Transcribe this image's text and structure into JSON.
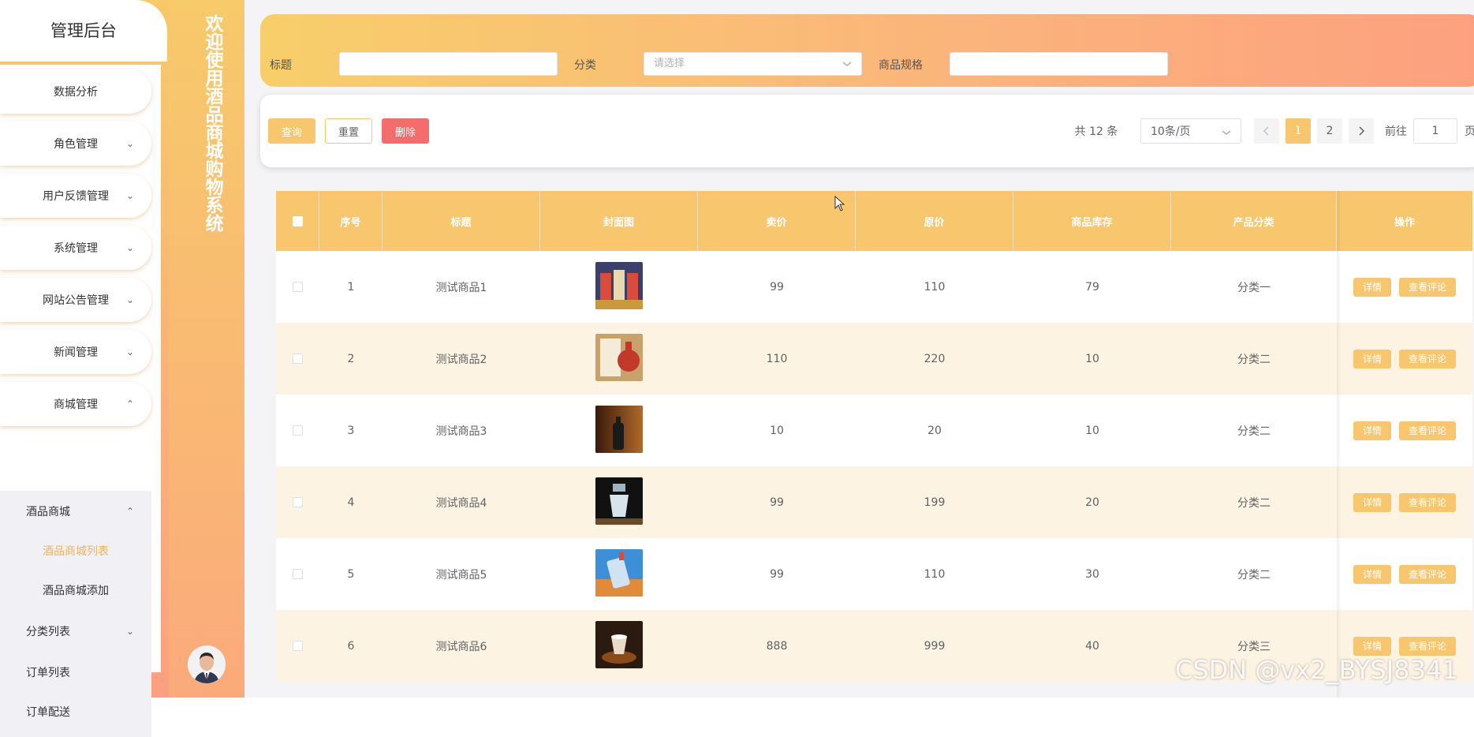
{
  "sidebar": {
    "title": "管理后台",
    "items": [
      {
        "label": "数据分析",
        "chevron": ""
      },
      {
        "label": "角色管理",
        "chevron": "⌄"
      },
      {
        "label": "用户反馈管理",
        "chevron": "⌄"
      },
      {
        "label": "系统管理",
        "chevron": "⌄"
      },
      {
        "label": "网站公告管理",
        "chevron": "⌄"
      },
      {
        "label": "新闻管理",
        "chevron": "⌄"
      },
      {
        "label": "商城管理",
        "chevron": "⌃"
      }
    ],
    "sub": [
      {
        "label": "酒品商城",
        "chevron": "⌃"
      },
      {
        "label": "酒品商城列表",
        "chevron": ""
      },
      {
        "label": "酒品商城添加",
        "chevron": ""
      },
      {
        "label": "分类列表",
        "chevron": "⌄"
      },
      {
        "label": "订单列表",
        "chevron": ""
      },
      {
        "label": "订单配送",
        "chevron": ""
      }
    ]
  },
  "welcome": "欢迎使用酒品商城购物系统",
  "search": {
    "title_label": "标题",
    "category_label": "分类",
    "category_placeholder": "请选择",
    "spec_label": "商品规格"
  },
  "toolbar": {
    "query": "查询",
    "reset": "重置",
    "delete": "删除",
    "total": "共 12 条",
    "page_size": "10条/页",
    "page1": "1",
    "page2": "2",
    "goto_prefix": "前往",
    "goto_value": "1",
    "goto_suffix": "页"
  },
  "table": {
    "headers": [
      "序号",
      "标题",
      "封面图",
      "卖价",
      "原价",
      "商品库存",
      "产品分类",
      "操作"
    ],
    "rows": [
      {
        "no": "1",
        "title": "测试商品1",
        "sell": "99",
        "orig": "110",
        "stock": "79",
        "cat": "分类一"
      },
      {
        "no": "2",
        "title": "测试商品2",
        "sell": "110",
        "orig": "220",
        "stock": "10",
        "cat": "分类二"
      },
      {
        "no": "3",
        "title": "测试商品3",
        "sell": "10",
        "orig": "20",
        "stock": "10",
        "cat": "分类二"
      },
      {
        "no": "4",
        "title": "测试商品4",
        "sell": "99",
        "orig": "199",
        "stock": "20",
        "cat": "分类二"
      },
      {
        "no": "5",
        "title": "测试商品5",
        "sell": "99",
        "orig": "110",
        "stock": "30",
        "cat": "分类二"
      },
      {
        "no": "6",
        "title": "测试商品6",
        "sell": "888",
        "orig": "999",
        "stock": "40",
        "cat": "分类三"
      }
    ],
    "detail_btn": "详情",
    "review_btn": "查看评论"
  },
  "watermark": "CSDN @vx2_BYSJ8341",
  "colors": {
    "accent": "#f8c66c",
    "delete": "#f56c6c",
    "active_text": "#f0b35a"
  }
}
